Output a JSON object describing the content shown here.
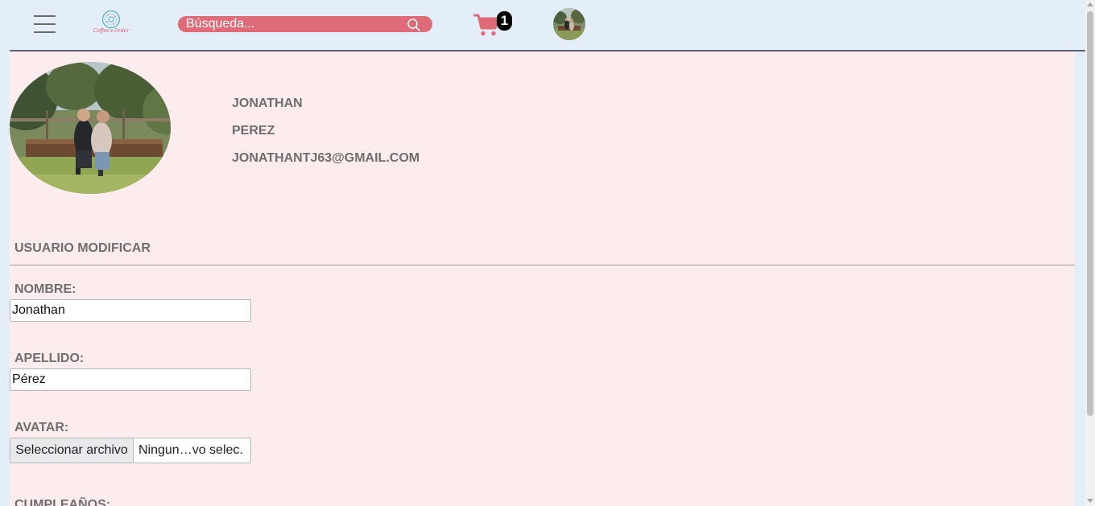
{
  "header": {
    "logo_text": "Coffee's Order",
    "search_placeholder": "Búsqueda...",
    "cart_count": "1"
  },
  "profile": {
    "first_name": "JONATHAN",
    "last_name": "PEREZ",
    "email": "JONATHANTJ63@GMAIL.COM"
  },
  "form": {
    "title": "USUARIO MODIFICAR",
    "nombre_label": "NOMBRE:",
    "nombre_value": "Jonathan",
    "apellido_label": "APELLIDO:",
    "apellido_value": "Pérez",
    "avatar_label": "AVATAR:",
    "file_button_label": "Seleccionar archivo",
    "file_status": "Ningun…vo selec.",
    "cumpleanos_label": "CUMPLEAÑOS:"
  },
  "icons": {
    "menu": "hamburger-icon",
    "search": "search-icon",
    "cart": "cart-icon"
  },
  "colors": {
    "header_bg": "#e3eef9",
    "panel_bg": "#fcecee",
    "accent": "#e06b78",
    "label_text": "#6e6e6e"
  }
}
